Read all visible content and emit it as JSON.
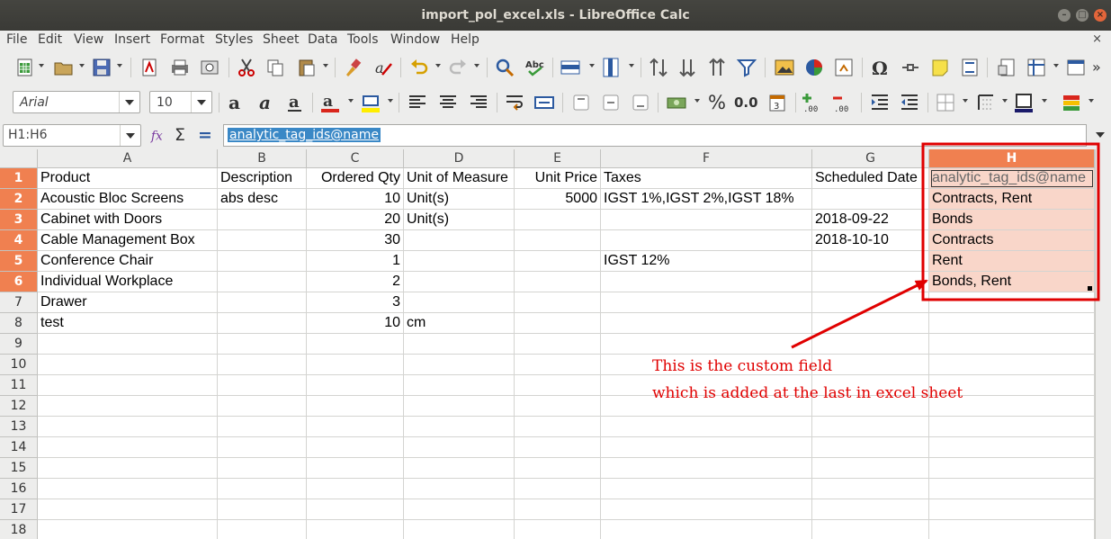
{
  "window": {
    "title": "import_pol_excel.xls - LibreOffice Calc"
  },
  "menu": [
    "File",
    "Edit",
    "View",
    "Insert",
    "Format",
    "Styles",
    "Sheet",
    "Data",
    "Tools",
    "Window",
    "Help"
  ],
  "doc_close": "×",
  "format_toolbar": {
    "font_name": "Arial",
    "font_size": "10",
    "percent": "%",
    "decimal": "0.0"
  },
  "formula_bar": {
    "name_box": "H1:H6",
    "content": "analytic_tag_ids@name"
  },
  "columns": [
    "A",
    "B",
    "C",
    "D",
    "E",
    "F",
    "G",
    "H"
  ],
  "selected_column": "H",
  "rows": [
    {
      "n": "1",
      "A": "Product",
      "B": "Description",
      "C": "Ordered Qty",
      "D": "Unit of Measure",
      "E": "Unit Price",
      "F": "Taxes",
      "G": "Scheduled Date",
      "H": "analytic_tag_ids@name"
    },
    {
      "n": "2",
      "A": "Acoustic Bloc Screens",
      "B": "abs desc",
      "C": "10",
      "D": "Unit(s)",
      "E": "5000",
      "F": "IGST 1%,IGST 2%,IGST 18%",
      "G": "",
      "H": "Contracts, Rent"
    },
    {
      "n": "3",
      "A": "Cabinet with Doors",
      "B": "",
      "C": "20",
      "D": "Unit(s)",
      "E": "",
      "F": "",
      "G": "2018-09-22",
      "H": "Bonds"
    },
    {
      "n": "4",
      "A": "Cable Management Box",
      "B": "",
      "C": "30",
      "D": "",
      "E": "",
      "F": "",
      "G": "2018-10-10",
      "H": "Contracts"
    },
    {
      "n": "5",
      "A": "Conference Chair",
      "B": "",
      "C": "1",
      "D": "",
      "E": "",
      "F": "IGST 12%",
      "G": "",
      "H": "Rent"
    },
    {
      "n": "6",
      "A": "Individual Workplace",
      "B": "",
      "C": "2",
      "D": "",
      "E": "",
      "F": "",
      "G": "",
      "H": "Bonds, Rent"
    },
    {
      "n": "7",
      "A": "Drawer",
      "B": "",
      "C": "3",
      "D": "",
      "E": "",
      "F": "",
      "G": "",
      "H": ""
    },
    {
      "n": "8",
      "A": "test",
      "B": "",
      "C": "10",
      "D": "cm",
      "E": "",
      "F": "",
      "G": "",
      "H": ""
    },
    {
      "n": "9"
    },
    {
      "n": "10"
    },
    {
      "n": "11"
    },
    {
      "n": "12"
    },
    {
      "n": "13"
    },
    {
      "n": "14"
    },
    {
      "n": "15"
    },
    {
      "n": "16"
    },
    {
      "n": "17"
    },
    {
      "n": "18"
    }
  ],
  "annotation": {
    "line1": "This is the custom field",
    "line2": "which is added at the last in excel sheet",
    "color": "#e00000"
  },
  "colors": {
    "selection_header": "#f08050",
    "selection_fill": "#f9d6c9"
  }
}
